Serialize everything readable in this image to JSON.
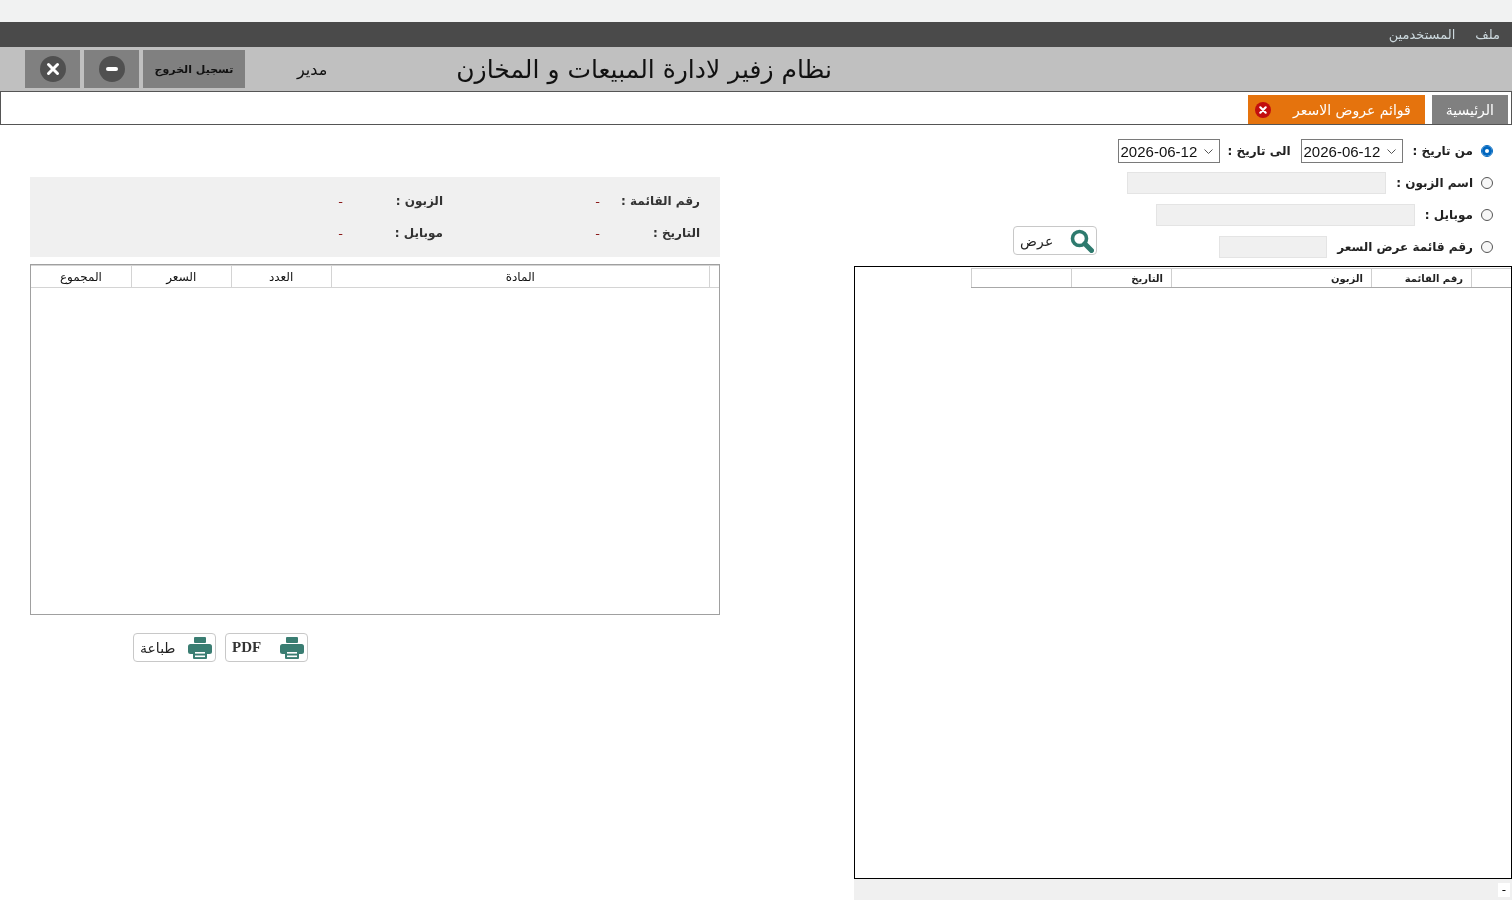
{
  "menu_bar": [
    "ملف",
    "المستخدمين"
  ],
  "header": {
    "title": "نظام زفير لادارة المبيعات و المخازن",
    "user_role": "مدير",
    "logout_button": "تسجيل الخروج"
  },
  "tabs": [
    {
      "label": "الرئيسية",
      "selected": false,
      "closable": false
    },
    {
      "label": "قوائم عروض الاسعر",
      "selected": true,
      "closable": true
    }
  ],
  "filters": {
    "options": [
      {
        "kind": "date_range",
        "label": "من تاريخ :",
        "selected": true,
        "from_value": "2026-06-12",
        "to_label": "الى تاريخ :",
        "to_value": "2026-06-12"
      },
      {
        "kind": "text",
        "label": "اسم الزبون :",
        "selected": false
      },
      {
        "kind": "text",
        "label": "موبايل :",
        "selected": false
      },
      {
        "kind": "text",
        "label": "رقم قائمة عرض السعر",
        "selected": false
      }
    ],
    "search_button": "عرض"
  },
  "quotes_table": {
    "columns": [
      "رقم القائمة",
      "الزبون",
      "التاريخ"
    ]
  },
  "status_bar": "-",
  "details": {
    "fields": [
      {
        "label": "رقم القائمة :",
        "value": "-"
      },
      {
        "label": "الزبون :",
        "value": "-"
      },
      {
        "label": "التاريخ :",
        "value": "-"
      },
      {
        "label": "موبايل :",
        "value": "-"
      }
    ]
  },
  "items_table": {
    "columns": [
      "المادة",
      "العدد",
      "السعر",
      "المجموع"
    ]
  },
  "buttons": [
    {
      "kind": "pdf",
      "label": "PDF"
    },
    {
      "kind": "print",
      "label": "طباعة"
    }
  ]
}
